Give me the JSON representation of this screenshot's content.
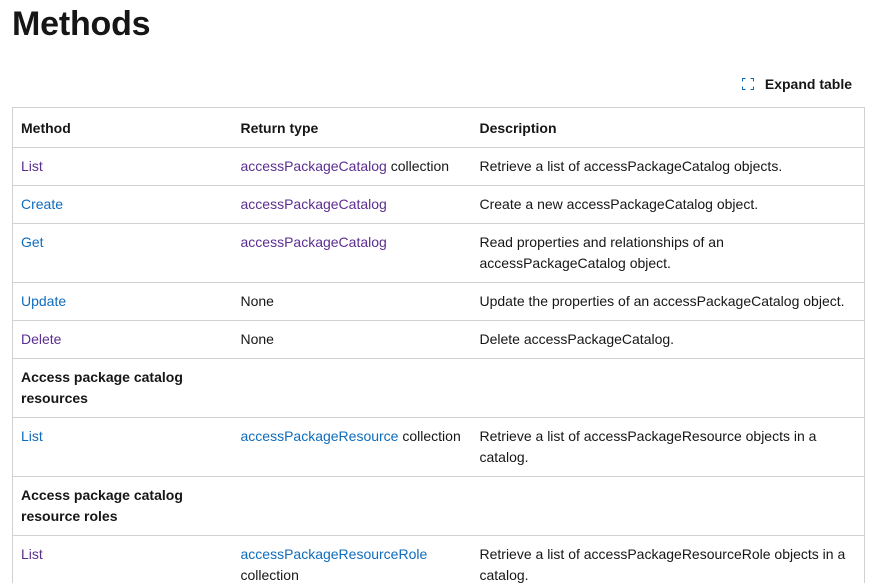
{
  "heading": "Methods",
  "expand_label": "Expand table",
  "columns": [
    "Method",
    "Return type",
    "Description"
  ],
  "rows": [
    {
      "method": "List",
      "return_link": "accessPackageCatalog",
      "return_suffix": " collection",
      "description": "Retrieve a list of accessPackageCatalog objects."
    },
    {
      "method": "Create",
      "return_link": "accessPackageCatalog",
      "return_suffix": "",
      "description": "Create a new accessPackageCatalog object."
    },
    {
      "method": "Get",
      "return_link": "accessPackageCatalog",
      "return_suffix": "",
      "description": "Read properties and relationships of an accessPackageCatalog object."
    },
    {
      "method": "Update",
      "return_text": "None",
      "description": "Update the properties of an accessPackageCatalog object."
    },
    {
      "method": "Delete",
      "return_text": "None",
      "description": "Delete accessPackageCatalog."
    },
    {
      "section": "Access package catalog resources"
    },
    {
      "method": "List",
      "return_link": "accessPackageResource",
      "return_suffix": " collection",
      "description": "Retrieve a list of accessPackageResource objects in a catalog."
    },
    {
      "section": "Access package catalog resource roles"
    },
    {
      "method": "List",
      "return_link": "accessPackageResourceRole",
      "return_suffix": " collection",
      "description": "Retrieve a list of accessPackageResourceRole objects in a catalog."
    }
  ],
  "colors": {
    "link": "#0f6cbd",
    "visited_link": "#5c2e91",
    "text": "#161616",
    "border": "#d1d1d1"
  }
}
